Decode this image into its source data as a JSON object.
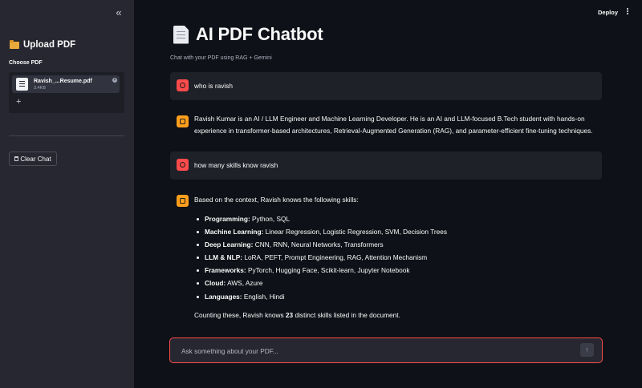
{
  "sidebar": {
    "collapse_icon": "«",
    "title": "Upload PDF",
    "choose_label": "Choose PDF",
    "file": {
      "name": "Ravish_...Resume.pdf",
      "size": "3.4KB",
      "remove_icon": "×"
    },
    "add_icon": "+",
    "clear_button": "Clear Chat"
  },
  "header": {
    "deploy_label": "Deploy"
  },
  "main": {
    "title": "AI PDF Chatbot",
    "subtitle": "Chat with your PDF using RAG + Gemini"
  },
  "messages": [
    {
      "role": "user",
      "text": "who is ravish"
    },
    {
      "role": "assistant",
      "text": "Ravish Kumar is an AI / LLM Engineer and Machine Learning Developer. He is an AI and LLM-focused B.Tech student with hands-on experience in transformer-based architectures, Retrieval-Augmented Generation (RAG), and parameter-efficient fine-tuning techniques."
    },
    {
      "role": "user",
      "text": "how many skills know ravish"
    },
    {
      "role": "assistant",
      "intro": "Based on the context, Ravish knows the following skills:",
      "skills": [
        {
          "label": "Programming:",
          "value": "Python, SQL"
        },
        {
          "label": "Machine Learning:",
          "value": "Linear Regression, Logistic Regression, SVM, Decision Trees"
        },
        {
          "label": "Deep Learning:",
          "value": "CNN, RNN, Neural Networks, Transformers"
        },
        {
          "label": "LLM & NLP:",
          "value": "LoRA, PEFT, Prompt Engineering, RAG, Attention Mechanism"
        },
        {
          "label": "Frameworks:",
          "value": "PyTorch, Hugging Face, Scikit-learn, Jupyter Notebook"
        },
        {
          "label": "Cloud:",
          "value": "AWS, Azure"
        },
        {
          "label": "Languages:",
          "value": "English, Hindi"
        }
      ],
      "summary_before": "Counting these, Ravish knows ",
      "summary_count": "23",
      "summary_after": " distinct skills listed in the document."
    }
  ],
  "chat_input": {
    "placeholder": "Ask something about your PDF...",
    "send_icon": "↑"
  },
  "colors": {
    "accent": "#ff4b4b",
    "bot_avatar": "#ff9f1c",
    "sidebar_bg": "#262730",
    "main_bg": "#0e1117"
  }
}
